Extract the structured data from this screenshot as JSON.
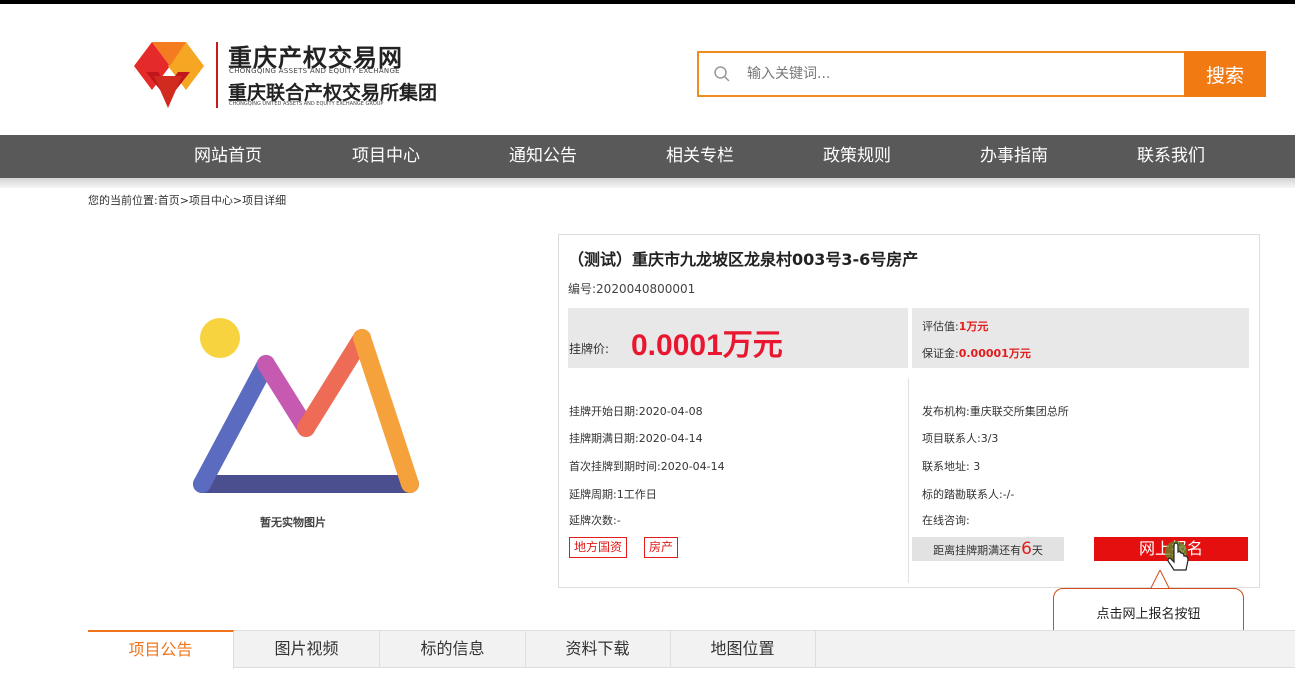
{
  "header": {
    "logo": {
      "cn_name": "重庆产权交易网",
      "en_name": "CHONGQING ASSETS AND EQUITY EXCHANGE",
      "cn_group": "重庆联合产权交易所集团",
      "en_group": "CHONGQING UNITED ASSETS AND EQUITY EXCHANGE GROUP"
    },
    "search": {
      "placeholder": "输入关键词...",
      "button_label": "搜索"
    }
  },
  "nav": {
    "items": [
      {
        "label": "网站首页"
      },
      {
        "label": "项目中心"
      },
      {
        "label": "通知公告"
      },
      {
        "label": "相关专栏"
      },
      {
        "label": "政策规则"
      },
      {
        "label": "办事指南"
      },
      {
        "label": "联系我们"
      }
    ]
  },
  "breadcrumb": "您的当前位置:首页>项目中心>项目详细",
  "image": {
    "placeholder_text": "暂无实物图片"
  },
  "project": {
    "title": "（测试）重庆市九龙坡区龙泉村003号3-6号房产",
    "code": "编号:2020040800001",
    "price_label": "挂牌价:",
    "price_value": "0.0001万元",
    "eval_label": "评估值:",
    "eval_value": "1万元",
    "deposit_label": "保证金:",
    "deposit_value": "0.00001万元",
    "left_info": [
      "挂牌开始日期:2020-04-08",
      "挂牌期满日期:2020-04-14",
      "首次挂牌到期时间:2020-04-14",
      "延牌周期:1工作日",
      "延牌次数:-"
    ],
    "right_info": [
      "发布机构:重庆联交所集团总所",
      "项目联系人:3/3",
      "联系地址: 3",
      "标的踏勘联系人:-/-",
      "在线咨询:"
    ],
    "tags": [
      "地方国资",
      "房产"
    ],
    "countdown_prefix": "距离挂牌期满还有",
    "countdown_days": "6",
    "countdown_suffix": "天",
    "signup_label": "网上报名"
  },
  "tooltip": "点击网上报名按钮",
  "tabs": [
    {
      "label": "项目公告",
      "active": true
    },
    {
      "label": "图片视频",
      "active": false
    },
    {
      "label": "标的信息",
      "active": false
    },
    {
      "label": "资料下载",
      "active": false
    },
    {
      "label": "地图位置",
      "active": false
    }
  ],
  "colors": {
    "accent_orange": "#f27a13",
    "nav_bg": "#595959",
    "price_red": "#e8172f",
    "button_red": "#e50f0f"
  }
}
